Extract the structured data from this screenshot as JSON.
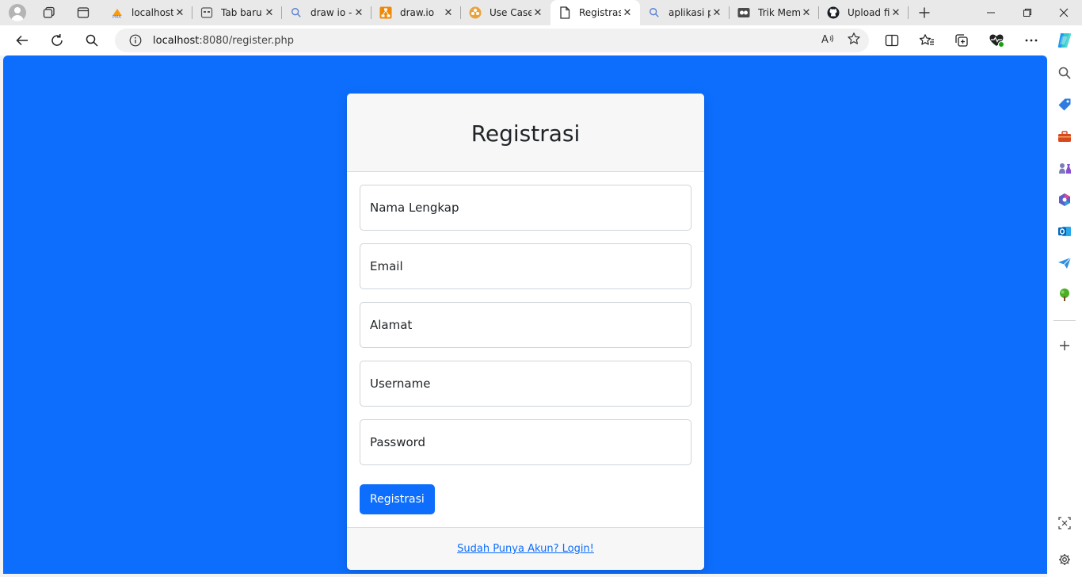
{
  "browser": {
    "tabs": [
      {
        "label": "localhost",
        "favicon": "phpmyadmin-icon"
      },
      {
        "label": "Tab baru",
        "favicon": "newtab-icon"
      },
      {
        "label": "draw io -",
        "favicon": "search-icon"
      },
      {
        "label": "draw.io",
        "favicon": "drawio-icon"
      },
      {
        "label": "Use Case",
        "favicon": "usecase-icon"
      },
      {
        "label": "Registrasi",
        "favicon": "page-icon",
        "active": true
      },
      {
        "label": "aplikasi p",
        "favicon": "search-icon"
      },
      {
        "label": "Trik Mem",
        "favicon": "video-icon"
      },
      {
        "label": "Upload fi",
        "favicon": "github-icon"
      }
    ],
    "url_host": "localhost",
    "url_path": ":8080/register.php",
    "colors": {
      "accent": "#0d6efd",
      "tabstrip": "#e9e9e9"
    }
  },
  "page": {
    "title": "Registrasi",
    "fields": {
      "nama_placeholder": "Nama Lengkap",
      "email_placeholder": "Email",
      "alamat_placeholder": "Alamat",
      "username_placeholder": "Username",
      "password_placeholder": "Password"
    },
    "submit_label": "Registrasi",
    "login_link": "Sudah Punya Akun? Login!"
  }
}
